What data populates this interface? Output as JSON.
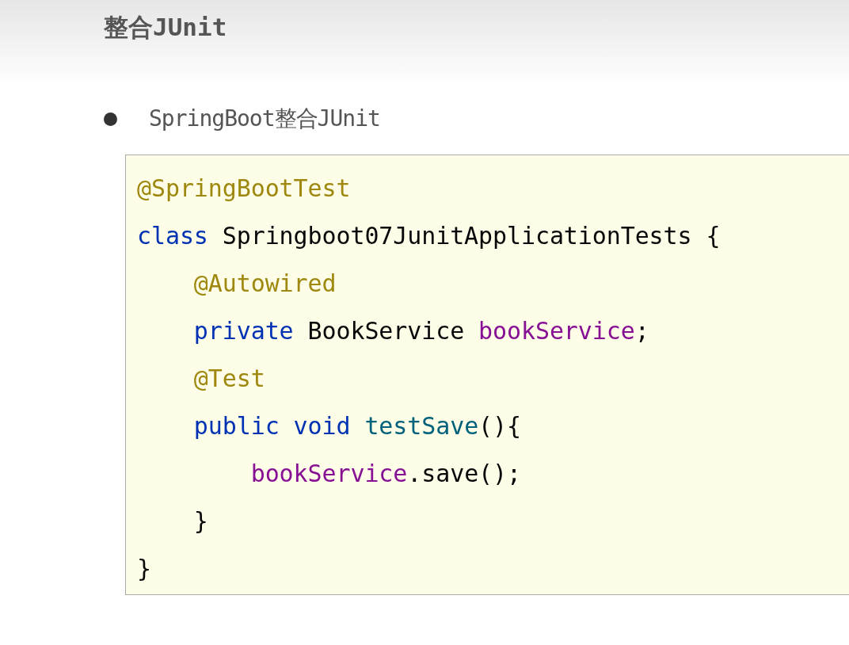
{
  "slide": {
    "title": "整合JUnit",
    "bullets": [
      {
        "text": "SpringBoot整合JUnit"
      }
    ],
    "code": {
      "lines": [
        {
          "tokens": [
            {
              "kind": "annotation",
              "text": "@SpringBootTest"
            }
          ]
        },
        {
          "tokens": [
            {
              "kind": "keyword",
              "text": "class"
            },
            {
              "kind": "plain",
              "text": " Springboot07JunitApplicationTests {"
            }
          ]
        },
        {
          "tokens": [
            {
              "kind": "annotation",
              "text": "    @Autowired"
            }
          ]
        },
        {
          "tokens": [
            {
              "kind": "keyword",
              "text": "    private"
            },
            {
              "kind": "plain",
              "text": " BookService "
            },
            {
              "kind": "field",
              "text": "bookService"
            },
            {
              "kind": "plain",
              "text": ";"
            }
          ]
        },
        {
          "tokens": [
            {
              "kind": "annotation",
              "text": "    @Test"
            }
          ]
        },
        {
          "tokens": [
            {
              "kind": "keyword",
              "text": "    public void"
            },
            {
              "kind": "method",
              "text": " testSave"
            },
            {
              "kind": "plain",
              "text": "(){"
            }
          ]
        },
        {
          "tokens": [
            {
              "kind": "field",
              "text": "        bookService"
            },
            {
              "kind": "plain",
              "text": ".save();"
            }
          ]
        },
        {
          "tokens": [
            {
              "kind": "plain",
              "text": "    }"
            }
          ]
        },
        {
          "tokens": [
            {
              "kind": "plain",
              "text": "}"
            }
          ]
        }
      ]
    }
  }
}
